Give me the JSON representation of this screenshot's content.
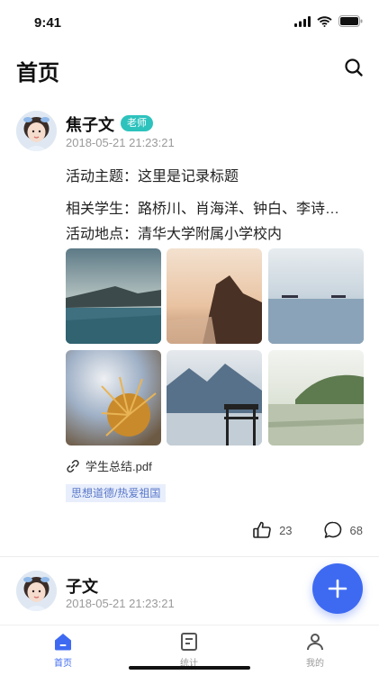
{
  "status_bar": {
    "time": "9:41"
  },
  "header": {
    "title": "首页",
    "search_icon": "search-icon"
  },
  "posts": [
    {
      "author": "焦子文",
      "role": "老师",
      "time": "2018-05-21  21:23:21",
      "theme_label": "活动主题：",
      "theme_value": "这里是记录标题",
      "students_label": "相关学生：",
      "students_value": "路桥川、肖海洋、钟白、李诗…",
      "place_label": "活动地点：",
      "place_value": "清华大学附属小学校内",
      "attachment": "学生总结.pdf",
      "tag": "思想道德/热爱祖国",
      "likes": "23",
      "comments": "68"
    },
    {
      "author": "子文",
      "time": "2018-05-21  21:23:21"
    }
  ],
  "tabs": [
    {
      "label": "首页",
      "icon": "home-icon",
      "active": true
    },
    {
      "label": "统计",
      "icon": "chart-icon",
      "active": false
    },
    {
      "label": "我的",
      "icon": "profile-icon",
      "active": false
    }
  ],
  "colors": {
    "accent": "#3e6af2",
    "badge": "#2ec2bd",
    "tag_bg": "#e8eefb",
    "tag_text": "#5a78c9"
  }
}
